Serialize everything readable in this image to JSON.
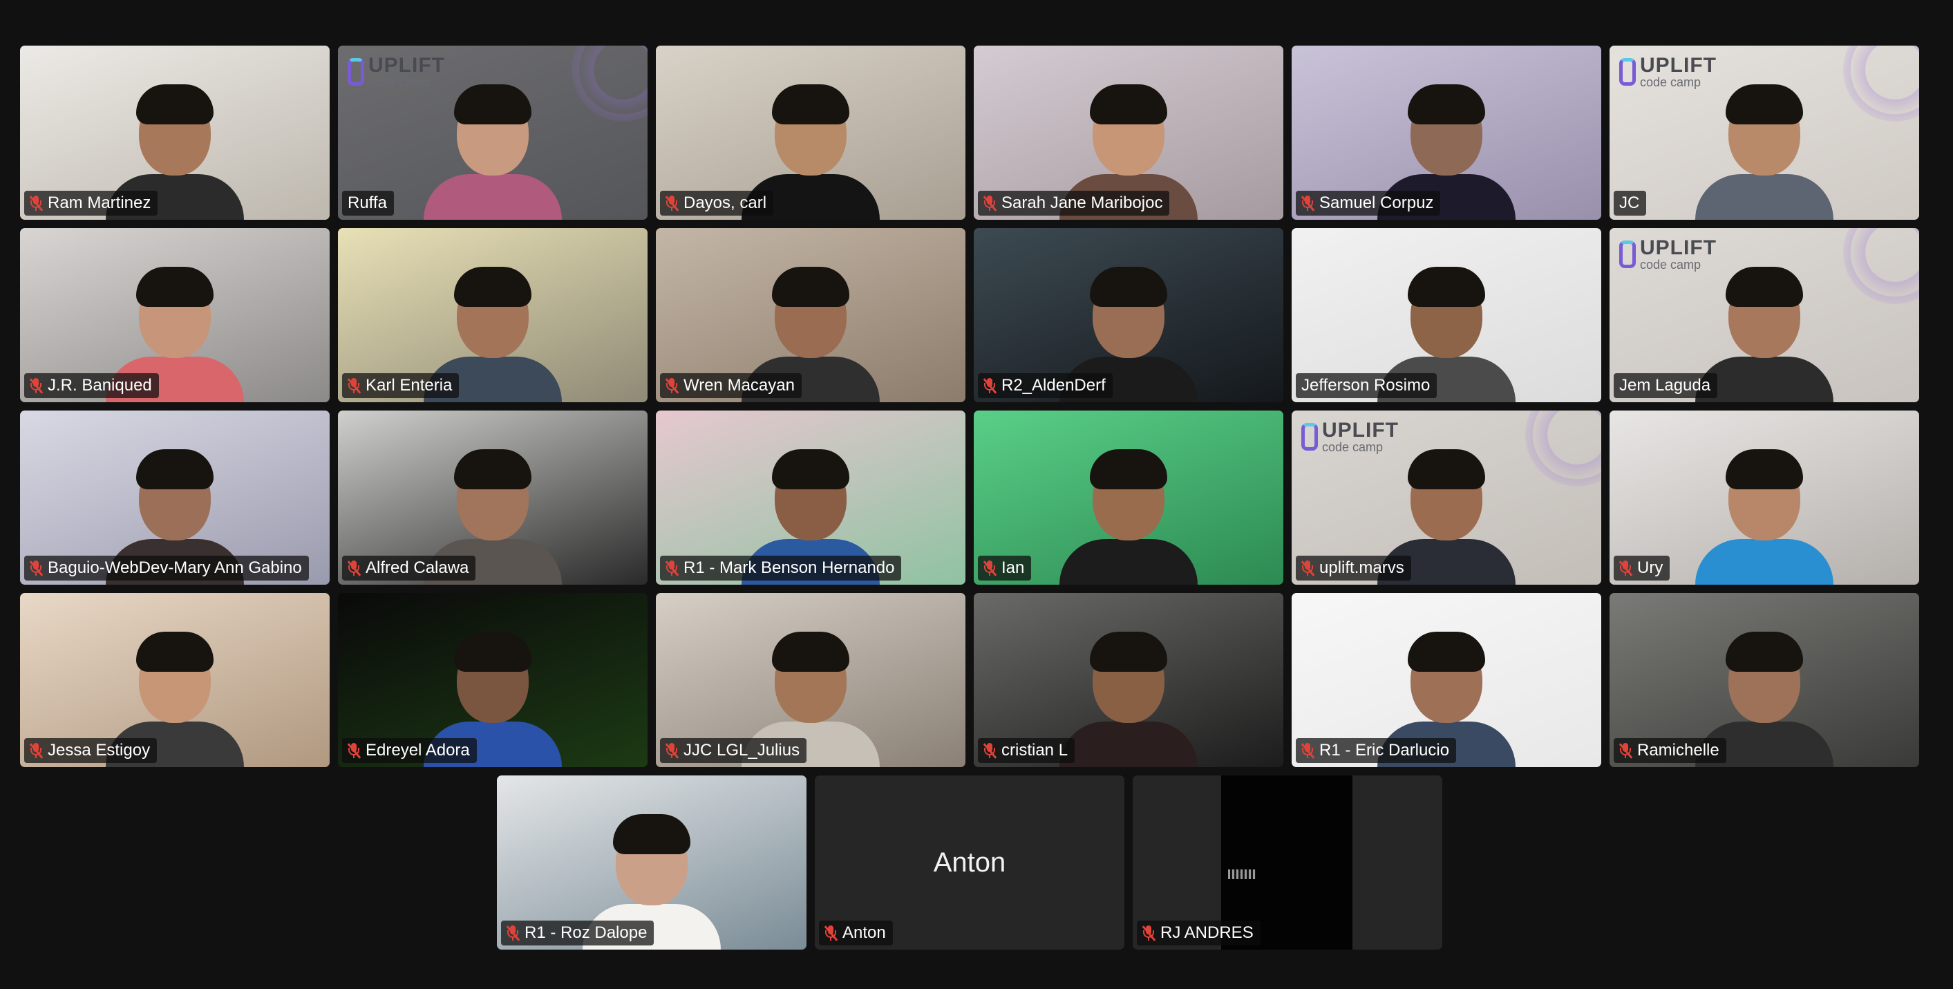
{
  "meeting": {
    "view": "Gallery View",
    "participants": [
      {
        "name": "Ram Martinez",
        "muted": true,
        "speaking": false,
        "video": {
          "bg": [
            "#eceae6",
            "#bdb7ad"
          ],
          "skin": "#a8785a",
          "shirt": "#2b2b2b",
          "branded": false
        }
      },
      {
        "name": "Ruffa",
        "muted": false,
        "speaking": false,
        "video": {
          "bg": [
            "#6d6d70",
            "#55565a"
          ],
          "skin": "#c89a80",
          "shirt": "#b05a7e",
          "branded": true
        }
      },
      {
        "name": "Dayos, carl",
        "muted": true,
        "speaking": false,
        "video": {
          "bg": [
            "#d8d2c8",
            "#a89f92"
          ],
          "skin": "#b78a68",
          "shirt": "#141414",
          "branded": false
        }
      },
      {
        "name": "Sarah Jane Maribojoc",
        "muted": true,
        "speaking": false,
        "video": {
          "bg": [
            "#d4ccd2",
            "#a59aa0"
          ],
          "skin": "#c79677",
          "shirt": "#6a4c40",
          "branded": false
        }
      },
      {
        "name": "Samuel Corpuz",
        "muted": true,
        "speaking": false,
        "video": {
          "bg": [
            "#c9c3d8",
            "#9990ac"
          ],
          "skin": "#8e6a56",
          "shirt": "#1d1a2c",
          "branded": false
        }
      },
      {
        "name": "JC",
        "muted": false,
        "speaking": false,
        "video": {
          "bg": [
            "#e5e1dd",
            "#cfcac4"
          ],
          "skin": "#b88a6a",
          "shirt": "#5d6472",
          "branded": true
        }
      },
      {
        "name": "J.R. Baniqued",
        "muted": true,
        "speaking": false,
        "video": {
          "bg": [
            "#d8d5d3",
            "#8c8a88"
          ],
          "skin": "#c6957a",
          "shirt": "#d9666a",
          "branded": false
        }
      },
      {
        "name": "Karl Enteria",
        "muted": true,
        "speaking": false,
        "video": {
          "bg": [
            "#e8e0b6",
            "#8f8a76"
          ],
          "skin": "#a47458",
          "shirt": "#3d4a5a",
          "branded": false
        }
      },
      {
        "name": "Wren Macayan",
        "muted": true,
        "speaking": false,
        "video": {
          "bg": [
            "#c4b6a6",
            "#8c7c6c"
          ],
          "skin": "#9a6c52",
          "shirt": "#2f2f2f",
          "branded": false
        }
      },
      {
        "name": "R2_AldenDerf",
        "muted": true,
        "speaking": false,
        "video": {
          "bg": [
            "#3d4a52",
            "#14181c"
          ],
          "skin": "#9a6e54",
          "shirt": "#1b1b1b",
          "branded": false
        }
      },
      {
        "name": "Jefferson Rosimo",
        "muted": false,
        "speaking": false,
        "video": {
          "bg": [
            "#f1f1f1",
            "#dcdcdc"
          ],
          "skin": "#8e6448",
          "shirt": "#4b4b4b",
          "branded": false
        }
      },
      {
        "name": "Jem Laguda",
        "muted": false,
        "speaking": true,
        "video": {
          "bg": [
            "#dedad6",
            "#c8c3be"
          ],
          "skin": "#a8785c",
          "shirt": "#2c2c2c",
          "branded": true
        }
      },
      {
        "name": "Baguio-WebDev-Mary Ann Gabino",
        "muted": true,
        "speaking": false,
        "video": {
          "bg": [
            "#d9d9e4",
            "#9a9aae"
          ],
          "skin": "#9c7058",
          "shirt": "#3a3030",
          "branded": false
        }
      },
      {
        "name": "Alfred Calawa",
        "muted": true,
        "speaking": false,
        "video": {
          "bg": [
            "#d0d0ce",
            "#2a2a2a"
          ],
          "skin": "#a0755c",
          "shirt": "#5a5550",
          "branded": false
        }
      },
      {
        "name": "R1 - Mark Benson Hernando",
        "muted": true,
        "speaking": false,
        "video": {
          "bg": [
            "#e6c8cf",
            "#8fc2a2"
          ],
          "skin": "#8a5e44",
          "shirt": "#2c5aa0",
          "branded": false
        }
      },
      {
        "name": "Ian",
        "muted": true,
        "speaking": false,
        "video": {
          "bg": [
            "#5acf88",
            "#2c8a52"
          ],
          "skin": "#9a6c4e",
          "shirt": "#1c1c1c",
          "branded": false
        }
      },
      {
        "name": "uplift.marvs",
        "muted": true,
        "speaking": false,
        "video": {
          "bg": [
            "#d9d5d1",
            "#c3beb8"
          ],
          "skin": "#9c6c50",
          "shirt": "#2a2d36",
          "branded": true
        }
      },
      {
        "name": "Ury",
        "muted": true,
        "speaking": false,
        "video": {
          "bg": [
            "#e8e6e4",
            "#b4b0ac"
          ],
          "skin": "#b88668",
          "shirt": "#2a8fd0",
          "branded": false
        }
      },
      {
        "name": "Jessa Estigoy",
        "muted": true,
        "speaking": false,
        "video": {
          "bg": [
            "#e8d8c6",
            "#b09880"
          ],
          "skin": "#c69676",
          "shirt": "#3a3a3a",
          "branded": false
        }
      },
      {
        "name": "Edreyel Adora",
        "muted": true,
        "speaking": false,
        "video": {
          "bg": [
            "#0a0a0a",
            "#1c3a14"
          ],
          "skin": "#7a5640",
          "shirt": "#2a52a8",
          "branded": false
        }
      },
      {
        "name": "JJC LGL_Julius",
        "muted": true,
        "speaking": false,
        "video": {
          "bg": [
            "#d6cfc6",
            "#8a8076"
          ],
          "skin": "#a27656",
          "shirt": "#c6c0b6",
          "branded": false
        }
      },
      {
        "name": "cristian L",
        "muted": true,
        "speaking": false,
        "video": {
          "bg": [
            "#6a6a68",
            "#1c1c1c"
          ],
          "skin": "#8a6044",
          "shirt": "#2a1e1e",
          "branded": false
        }
      },
      {
        "name": "R1 - Eric Darlucio",
        "muted": true,
        "speaking": false,
        "video": {
          "bg": [
            "#f7f7f7",
            "#e8e8e8"
          ],
          "skin": "#9e7056",
          "shirt": "#3a4a62",
          "branded": false
        }
      },
      {
        "name": "Ramichelle",
        "muted": true,
        "speaking": false,
        "video": {
          "bg": [
            "#7a7a76",
            "#3a3a38"
          ],
          "skin": "#9e7258",
          "shirt": "#2e2e2e",
          "branded": false
        }
      },
      {
        "name": "R1 - Roz Dalope",
        "muted": true,
        "speaking": false,
        "video": {
          "bg": [
            "#e4e6e8",
            "#7a8c96"
          ],
          "skin": "#caa088",
          "shirt": "#f4f2ee",
          "branded": false
        }
      },
      {
        "name": "Anton",
        "muted": true,
        "speaking": false,
        "video": null
      },
      {
        "name": "RJ ANDRES",
        "muted": true,
        "speaking": false,
        "video": {
          "bg": [
            "#020202",
            "#020202"
          ],
          "dark": true
        }
      }
    ]
  },
  "branding": {
    "title": "UPLIFT",
    "subtitle": "code camp"
  },
  "placeholder_name": "Anton",
  "colors": {
    "background": "#111111",
    "tile": "#262626",
    "active_speaker": "#63d35a",
    "muted_icon": "#e0433a"
  }
}
